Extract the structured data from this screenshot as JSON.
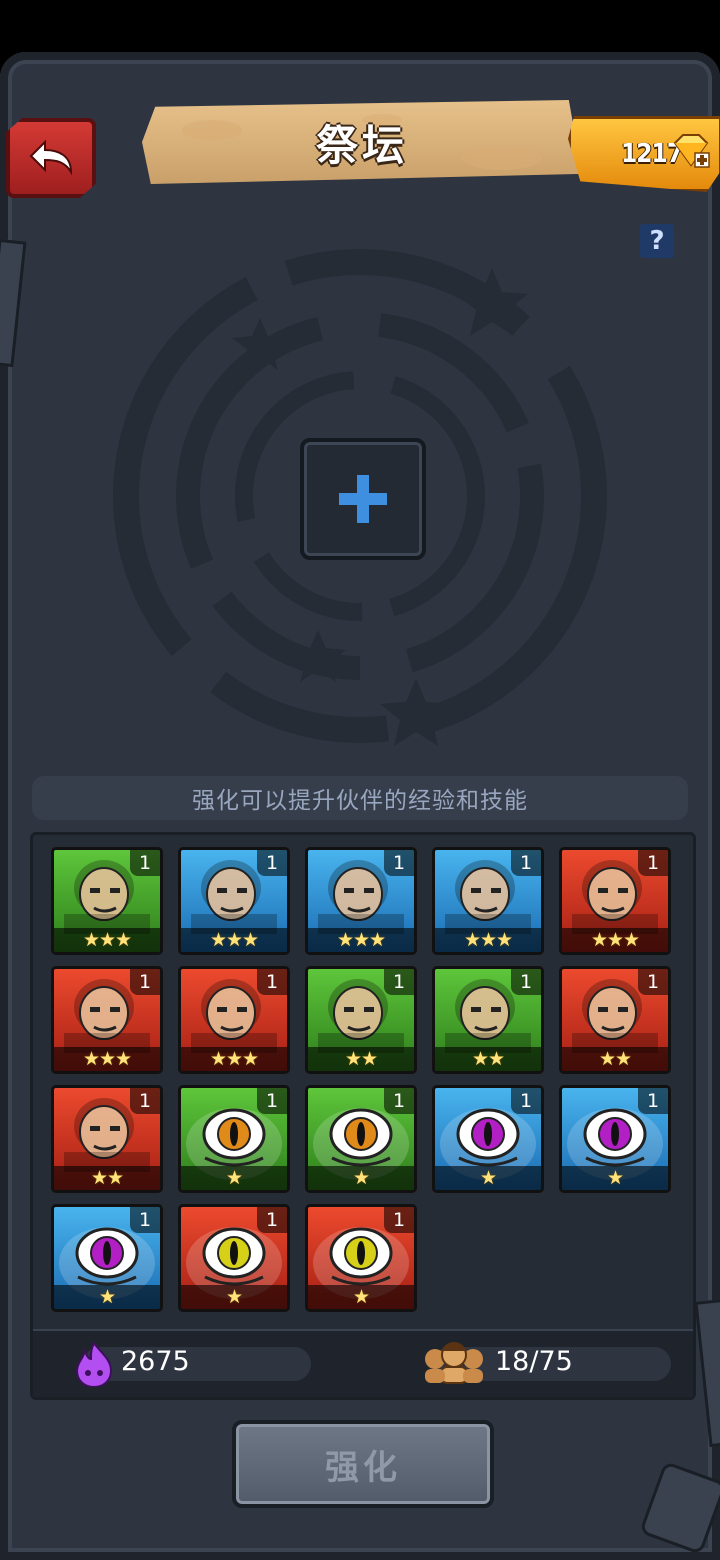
{
  "header": {
    "title": "祭坛",
    "gems": "1217",
    "help": "?"
  },
  "altar": {
    "hint": "强化可以提升伙伴的经验和技能"
  },
  "heroes": [
    {
      "level": "1",
      "stars": "★★★",
      "bg": "green",
      "icon": "bearded-warrior-portrait"
    },
    {
      "level": "1",
      "stars": "★★★",
      "bg": "blue",
      "icon": "blonde-heroine-portrait"
    },
    {
      "level": "1",
      "stars": "★★★",
      "bg": "blue",
      "icon": "boar-beast-portrait"
    },
    {
      "level": "1",
      "stars": "★★★",
      "bg": "blue",
      "icon": "blue-lizard-portrait"
    },
    {
      "level": "1",
      "stars": "★★★",
      "bg": "red",
      "icon": "red-haired-warrior-portrait"
    },
    {
      "level": "1",
      "stars": "★★★",
      "bg": "red",
      "icon": "werewolf-portrait"
    },
    {
      "level": "1",
      "stars": "★★★",
      "bg": "red",
      "icon": "dark-sorceress-portrait"
    },
    {
      "level": "1",
      "stars": "★★",
      "bg": "green",
      "icon": "green-ogre-portrait"
    },
    {
      "level": "1",
      "stars": "★★",
      "bg": "green",
      "icon": "treant-portrait"
    },
    {
      "level": "1",
      "stars": "★★",
      "bg": "red",
      "icon": "red-ogre-portrait"
    },
    {
      "level": "1",
      "stars": "★★",
      "bg": "red",
      "icon": "red-haired-rogue-portrait"
    },
    {
      "level": "1",
      "stars": "★",
      "bg": "green",
      "icon": "green-eye-slime-portrait"
    },
    {
      "level": "1",
      "stars": "★",
      "bg": "green",
      "icon": "green-eye-slime-portrait"
    },
    {
      "level": "1",
      "stars": "★",
      "bg": "blue",
      "icon": "blue-eye-slime-portrait"
    },
    {
      "level": "1",
      "stars": "★",
      "bg": "blue",
      "icon": "blue-eye-slime-portrait"
    },
    {
      "level": "1",
      "stars": "★",
      "bg": "blue",
      "icon": "blue-eye-slime-portrait"
    },
    {
      "level": "1",
      "stars": "★",
      "bg": "red",
      "icon": "red-eye-slime-portrait"
    },
    {
      "level": "1",
      "stars": "★",
      "bg": "red",
      "icon": "red-eye-slime-portrait"
    }
  ],
  "stats": {
    "essence": "2675",
    "party": "18/75"
  },
  "actions": {
    "enhance": "强化"
  },
  "colors": {
    "panel": "#2e3541",
    "accent_gold": "#ffc640",
    "back_red": "#d43a35"
  }
}
